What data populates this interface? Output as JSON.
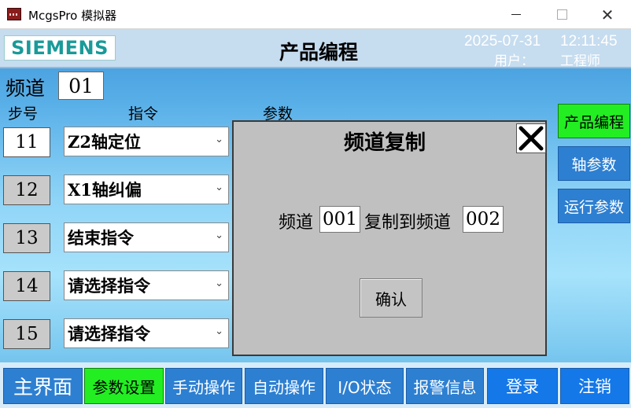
{
  "window": {
    "title": "McgsPro 模拟器",
    "close_glyph": "✕"
  },
  "header": {
    "logo": "SIEMENS",
    "title": "产品编程",
    "date": "2025-07-31",
    "time": "12:11:45",
    "user_label": "用户：",
    "user": "工程师"
  },
  "channel": {
    "label": "频道",
    "value": "01"
  },
  "columns": {
    "step": "步号",
    "command": "指令",
    "params": "参数"
  },
  "rows": [
    {
      "step": "11",
      "command": "Z2轴定位",
      "active": true
    },
    {
      "step": "12",
      "command": "X1轴纠偏",
      "active": false
    },
    {
      "step": "13",
      "command": "结束指令",
      "active": false
    },
    {
      "step": "14",
      "command": "请选择指令",
      "active": false
    },
    {
      "step": "15",
      "command": "请选择指令",
      "active": false
    }
  ],
  "dropdown_arrow": "⌄",
  "side_buttons": [
    {
      "label": "产品编程",
      "active": true
    },
    {
      "label": "轴参数",
      "active": false
    },
    {
      "label": "运行参数",
      "active": false
    }
  ],
  "dialog": {
    "title": "频道复制",
    "source_label": "频道",
    "source_value": "001",
    "target_label": "复制到频道",
    "target_value": "002",
    "confirm": "确认"
  },
  "nav": [
    {
      "label": "主界面",
      "style": "home"
    },
    {
      "label": "参数设置",
      "style": "active"
    },
    {
      "label": "手动操作",
      "style": ""
    },
    {
      "label": "自动操作",
      "style": ""
    },
    {
      "label": "I/O状态",
      "style": ""
    },
    {
      "label": "报警信息",
      "style": ""
    },
    {
      "label": "登录",
      "style": "big"
    },
    {
      "label": "注销",
      "style": "big"
    }
  ],
  "colors": {
    "active_green": "#22ee22",
    "button_blue": "#2d7fd1",
    "logo_teal": "#1a9a99"
  }
}
